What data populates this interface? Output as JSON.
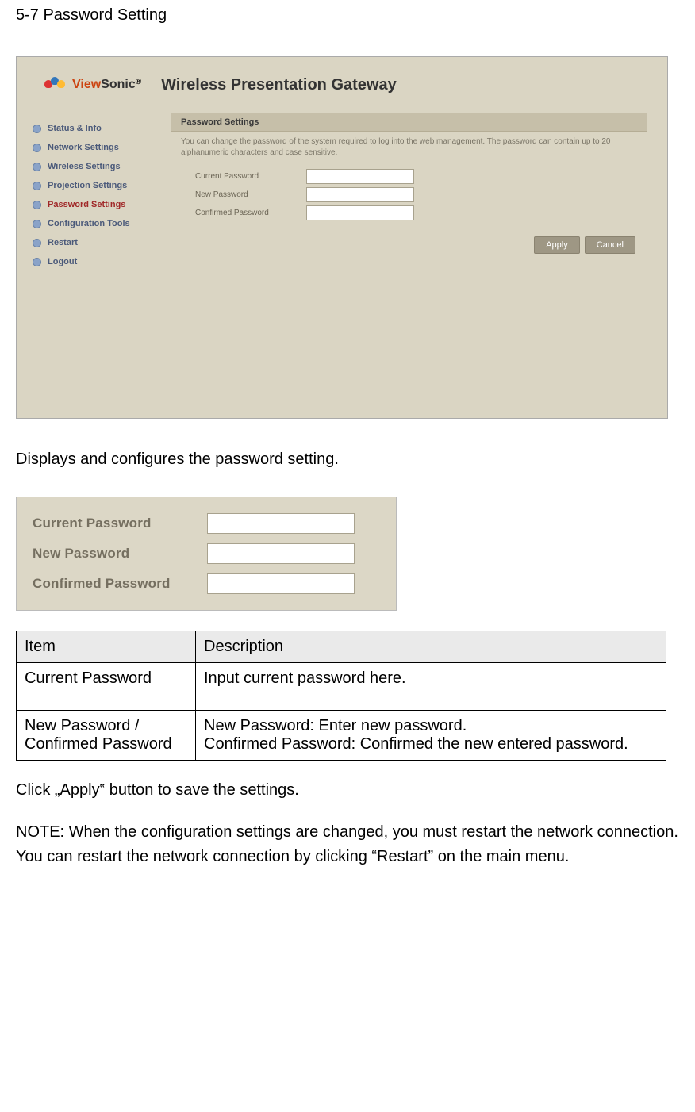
{
  "section_title": "5-7 Password Setting",
  "screenshot1": {
    "brand_view": "View",
    "brand_sonic": "Sonic",
    "brand_reg": "®",
    "header_title": "Wireless Presentation Gateway",
    "sidebar": [
      {
        "label": "Status & Info",
        "active": false
      },
      {
        "label": "Network Settings",
        "active": false
      },
      {
        "label": "Wireless Settings",
        "active": false
      },
      {
        "label": "Projection Settings",
        "active": false
      },
      {
        "label": "Password Settings",
        "active": true
      },
      {
        "label": "Configuration Tools",
        "active": false
      },
      {
        "label": "Restart",
        "active": false
      },
      {
        "label": "Logout",
        "active": false
      }
    ],
    "panel_title": "Password Settings",
    "panel_desc": "You can change the password of the system required to log into the web management. The password can contain up to 20 alphanumeric characters and case sensitive.",
    "fields": {
      "current": "Current Password",
      "new": "New Password",
      "confirm": "Confirmed Password"
    },
    "buttons": {
      "apply": "Apply",
      "cancel": "Cancel"
    }
  },
  "caption": "Displays and configures the password setting.",
  "screenshot2": {
    "current": "Current Password",
    "new": "New Password",
    "confirm": "Confirmed Password"
  },
  "table": {
    "head_item": "Item",
    "head_desc": "Description",
    "rows": [
      {
        "item": "Current Password",
        "desc": "Input current password here."
      },
      {
        "item": "New Password / Confirmed Password",
        "desc": "New Password: Enter new password.\nConfirmed Password: Confirmed the new entered password."
      }
    ]
  },
  "apply_text": "Click „Apply‟ button to save the settings.",
  "note_text": "NOTE: When the configuration settings are changed, you must restart the network connection. You can restart the network connection by clicking “Restart” on the main menu."
}
